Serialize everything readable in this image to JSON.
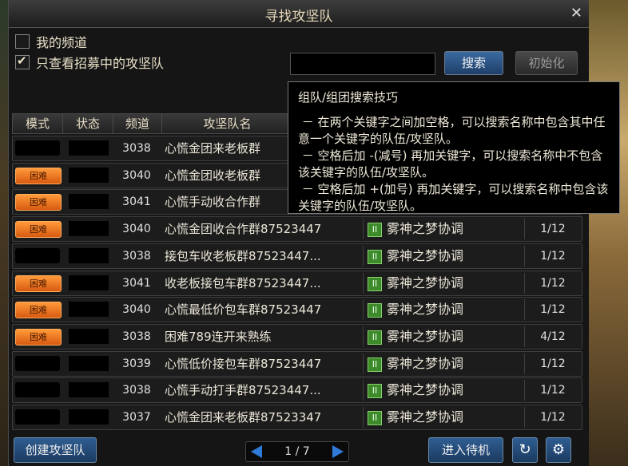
{
  "window": {
    "title": "寻找攻坚队",
    "close_icon": "✕"
  },
  "filters": {
    "my_channel": {
      "label": "我的频道",
      "checked": false
    },
    "only_recruiting": {
      "label": "只查看招募中的攻坚队",
      "checked": true
    }
  },
  "search": {
    "value": "",
    "search_label": "搜索",
    "reset_label": "初始化"
  },
  "columns": {
    "mode": "模式",
    "status": "状态",
    "channel": "频道",
    "name": "攻坚队名"
  },
  "rows": [
    {
      "mode": "",
      "channel": "3038",
      "name": "心慌金团来老板群",
      "guild": "",
      "count": ""
    },
    {
      "mode": "困难",
      "channel": "3040",
      "name": "心慌金团收老板群",
      "guild": "",
      "count": ""
    },
    {
      "mode": "困难",
      "channel": "3041",
      "name": "心慌手动收合作群",
      "guild": "",
      "count": ""
    },
    {
      "mode": "困难",
      "channel": "3040",
      "name": "心慌金团收合作群87523447",
      "guild": "雾神之梦协调",
      "count": "1/12"
    },
    {
      "mode": "",
      "channel": "3038",
      "name": "接包车收老板群87523447...",
      "guild": "雾神之梦协调",
      "count": "1/12"
    },
    {
      "mode": "困难",
      "channel": "3041",
      "name": "收老板接包车群87523447...",
      "guild": "雾神之梦协调",
      "count": "1/12"
    },
    {
      "mode": "困难",
      "channel": "3040",
      "name": "心慌最低价包车群87523447",
      "guild": "雾神之梦协调",
      "count": "1/12"
    },
    {
      "mode": "困难",
      "channel": "3038",
      "name": "困难789连开来熟练",
      "guild": "雾神之梦协调",
      "count": "4/12"
    },
    {
      "mode": "",
      "channel": "3039",
      "name": "心慌低价接包车群87523447",
      "guild": "雾神之梦协调",
      "count": "1/12"
    },
    {
      "mode": "",
      "channel": "3038",
      "name": "心慌手动打手群87523447...",
      "guild": "雾神之梦协调",
      "count": "1/12"
    },
    {
      "mode": "",
      "channel": "3037",
      "name": "心慌金团来老板群87523347",
      "guild": "雾神之梦协调",
      "count": "1/12"
    }
  ],
  "tooltip": {
    "title": "组队/组团搜索技巧",
    "body": " － 在两个关键字之间加空格，可以搜索名称中包含其中任意一个关键字的队伍/攻坚队。\n － 空格后加 -(减号) 再加关键字，可以搜索名称中不包含该关键字的队伍/攻坚队。\n － 空格后加 +(加号) 再加关键字，可以搜索名称中包含该关键字的队伍/攻坚队。"
  },
  "footer": {
    "create_label": "创建攻坚队",
    "page": "1 / 7",
    "enter_label": "进入待机",
    "refresh_icon": "↻",
    "settings_icon": "⚙"
  }
}
